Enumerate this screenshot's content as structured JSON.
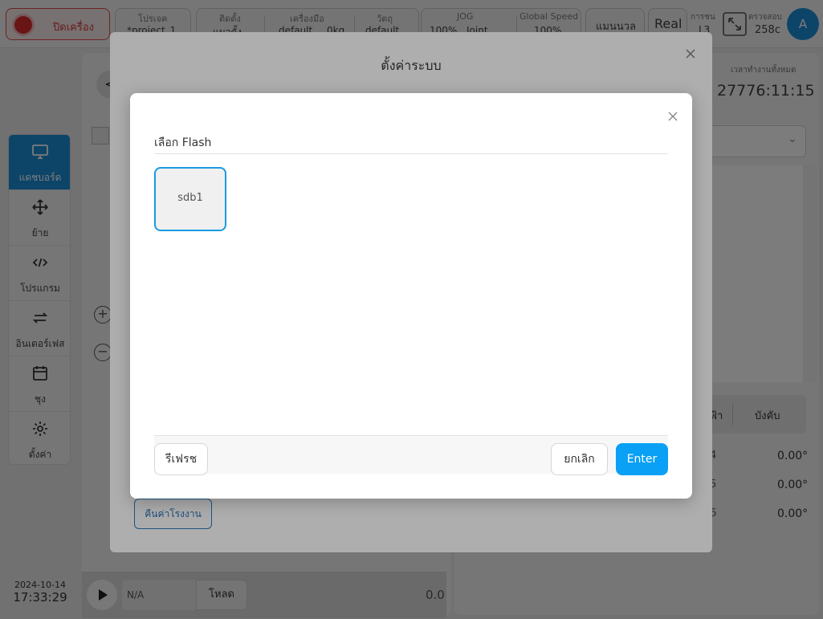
{
  "topbar": {
    "power_label": "ปิดเครื่อง",
    "project": {
      "label": "โปรเจค",
      "value": "*project_1"
    },
    "install": {
      "label": "ติดตั้ง",
      "value": "แมวตั้ง"
    },
    "tool": {
      "label": "เครื่องมือ",
      "value": "default",
      "weight": "0kg"
    },
    "payload": {
      "label": "วัตถุ",
      "value": "default"
    },
    "jog": {
      "label": "JOG",
      "value": "100%",
      "mode": "Joint"
    },
    "global_speed": {
      "label": "Global Speed",
      "value": "100%"
    },
    "mode_label": "แมนนวล",
    "real_label": "Real",
    "collision": {
      "label": "การชน",
      "value": "L3"
    },
    "check": {
      "label": "ตรวจสอบ",
      "value": "258c"
    },
    "avatar_letter": "A"
  },
  "sidebar": {
    "items": [
      {
        "label": "แดชบอร์ด",
        "icon": "monitor-icon",
        "active": true
      },
      {
        "label": "ย้าย",
        "icon": "move-icon",
        "active": false
      },
      {
        "label": "โปรแกรม",
        "icon": "code-icon",
        "active": false
      },
      {
        "label": "อินเตอร์เฟส",
        "icon": "swap-icon",
        "active": false
      },
      {
        "label": "ชุง",
        "icon": "calendar-icon",
        "active": false
      },
      {
        "label": "ตั้งค่า",
        "icon": "gear-icon",
        "active": false
      }
    ]
  },
  "datetime": {
    "date": "2024-10-14",
    "time": "17:33:29"
  },
  "dashboard": {
    "uptime_label": "เวลาทำงานทั้งหมด",
    "uptime_value": "27776:11:15",
    "table_header": {
      "col1": "ไฟฟ้า",
      "col2": "บังคับ"
    },
    "joint_rows": [
      {
        "idx": "4",
        "value": "0.00°"
      },
      {
        "idx": "5",
        "value": "0.00°"
      },
      {
        "idx": "6",
        "value": "0.00°"
      }
    ],
    "program_field": "N/A",
    "load_label": "โหลด",
    "progress_value": "0.0"
  },
  "settings_dialog": {
    "title": "ตั้งค่าระบบ",
    "factory_reset_label": "คืนค่าโรงงาน"
  },
  "flash_modal": {
    "title": "เลือก Flash",
    "drives": [
      "sdb1"
    ],
    "refresh_label": "รีเฟรช",
    "cancel_label": "ยกเลิก",
    "enter_label": "Enter"
  },
  "colors": {
    "accent": "#09a0f5",
    "sidebar_active": "#1d8fd8",
    "power_red": "#d92d2d"
  }
}
